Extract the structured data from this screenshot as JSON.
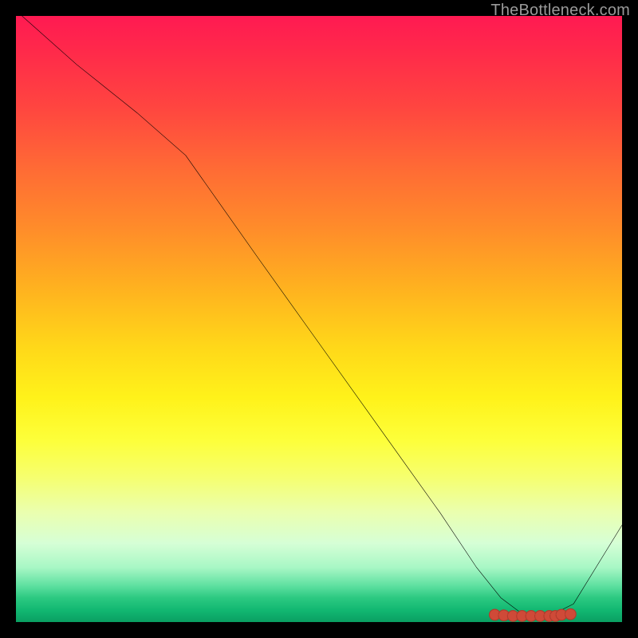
{
  "watermark": "TheBottleneck.com",
  "chart_data": {
    "type": "line",
    "title": "",
    "xlabel": "",
    "ylabel": "",
    "xlim": [
      0,
      100
    ],
    "ylim": [
      0,
      100
    ],
    "grid": false,
    "legend_position": "none",
    "background_gradient": {
      "direction": "vertical",
      "stops": [
        {
          "pos": 0.0,
          "color": "#ff1a52"
        },
        {
          "pos": 0.15,
          "color": "#ff4540"
        },
        {
          "pos": 0.35,
          "color": "#ff8c2a"
        },
        {
          "pos": 0.55,
          "color": "#ffd919"
        },
        {
          "pos": 0.7,
          "color": "#fdff3a"
        },
        {
          "pos": 0.85,
          "color": "#eaffb0"
        },
        {
          "pos": 0.95,
          "color": "#2cc981"
        },
        {
          "pos": 1.0,
          "color": "#0a9f62"
        }
      ]
    },
    "series": [
      {
        "name": "curve",
        "color": "#000000",
        "x": [
          1,
          10,
          20,
          28,
          40,
          50,
          60,
          70,
          76,
          80,
          84,
          88,
          92,
          100
        ],
        "y": [
          100,
          92,
          84,
          77,
          60,
          46,
          32,
          18,
          9,
          4,
          1,
          1,
          3,
          16
        ]
      },
      {
        "name": "optimal-band-markers",
        "type": "scatter",
        "color": "#d84c3a",
        "x": [
          79,
          80.5,
          82,
          83.5,
          85,
          86.5,
          88,
          89,
          90,
          91.5
        ],
        "y": [
          1.2,
          1.1,
          1.0,
          1.0,
          1.0,
          1.0,
          1.0,
          1.0,
          1.2,
          1.3
        ],
        "marker_size": 6
      }
    ],
    "optimal_range_x": [
      79,
      92
    ],
    "annotations": [
      {
        "text": "TheBottleneck.com",
        "position": "top-right",
        "role": "watermark"
      }
    ]
  }
}
